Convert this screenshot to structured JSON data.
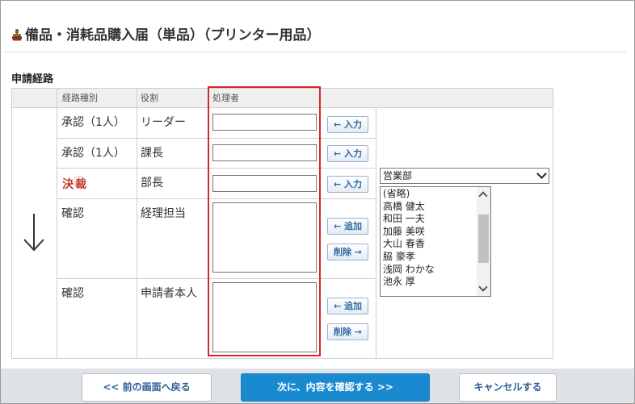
{
  "page": {
    "title": "備品・消耗品購入届（単品）（プリンター用品）",
    "section_title": "申請経路"
  },
  "route_table": {
    "headers": {
      "route_type": "経路種別",
      "role": "役割",
      "processor": "処理者"
    },
    "rows": [
      {
        "type": "承認（1人）",
        "role": "リーダー",
        "input_value": "",
        "button": "← 入力"
      },
      {
        "type": "承認（1人）",
        "role": "課長",
        "input_value": "",
        "button": "← 入力"
      },
      {
        "type": "決裁",
        "role": "部長",
        "input_value": "",
        "button": "← 入力"
      },
      {
        "type": "確認",
        "role": "経理担当",
        "add_button": "← 追加",
        "delete_button": "削除 →"
      },
      {
        "type": "確認",
        "role": "申請者本人",
        "add_button": "← 追加",
        "delete_button": "削除 →"
      }
    ]
  },
  "department_select": {
    "selected": "営業部"
  },
  "user_list": [
    "(省略)",
    "高橋 健太",
    "和田 一夫",
    "加藤 美咲",
    "大山 春香",
    "脇 豪孝",
    "浅岡 わかな",
    "池永 厚"
  ],
  "footer": {
    "back_label": "<< 前の画面へ戻る",
    "confirm_label": "次に、内容を確認する >>",
    "cancel_label": "キャンセルする"
  },
  "colors": {
    "highlight": "#d9262b",
    "primary": "#1a8ad0",
    "kessai": "#c0392b"
  },
  "icons": {
    "title_icon": "stamp-icon",
    "flow_icon": "down-arrow-icon"
  }
}
